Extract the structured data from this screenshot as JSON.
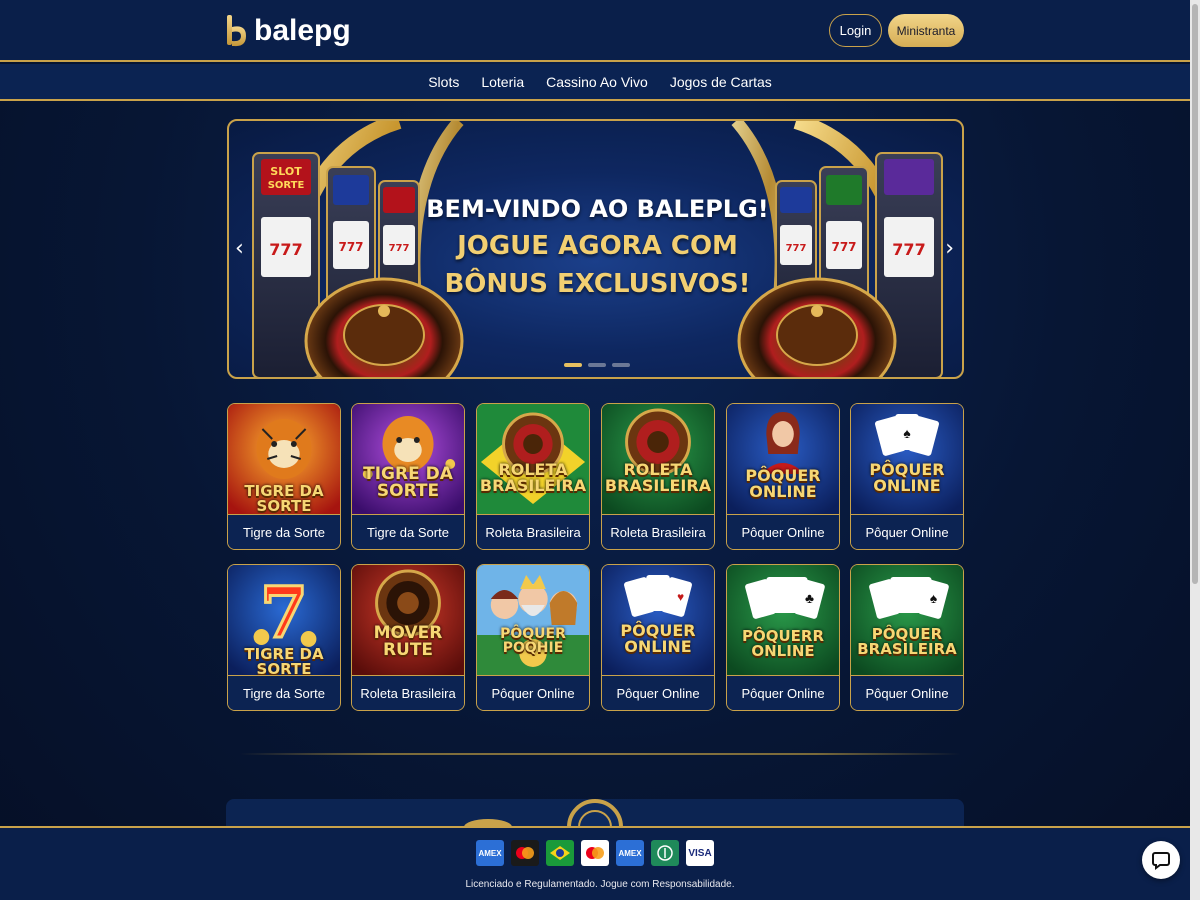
{
  "header": {
    "logo_text": "balepg",
    "login_label": "Login",
    "register_label": "Ministranta"
  },
  "nav": {
    "items": [
      {
        "label": "Slots"
      },
      {
        "label": "Loteria"
      },
      {
        "label": "Cassino Ao Vivo"
      },
      {
        "label": "Jogos de Cartas"
      }
    ]
  },
  "banner": {
    "line1": "BEM-VINDO AO BALEPLG!",
    "line2": "JOGUE AGORA COM",
    "line3": "BÔNUS EXCLUSIVOS!",
    "slide_count": 3,
    "active_slide": 1,
    "slot_sign_left": "SLOT SORTE"
  },
  "games": [
    {
      "title": "Tigre da Sorte",
      "art": "TIGRE DA SORTE",
      "theme": "tiger-red"
    },
    {
      "title": "Tigre da Sorte",
      "art": "TIGRE DA SORTE",
      "theme": "tiger-purple"
    },
    {
      "title": "Roleta Brasileira",
      "art": "ROLETA BRASILEIRA",
      "theme": "roulette-brazil"
    },
    {
      "title": "Roleta Brasileira",
      "art": "ROLETA BRASILEIRA",
      "theme": "roulette-green"
    },
    {
      "title": "Pôquer Online",
      "art": "PÔQUER ONLINE",
      "theme": "poker-dealer"
    },
    {
      "title": "Pôquer Online",
      "art": "PÔQUER ONLINE",
      "theme": "poker-cards-blue"
    },
    {
      "title": "Tigre da Sorte",
      "art": "TIGRE DA SORTE",
      "theme": "seven-blue"
    },
    {
      "title": "Roleta Brasileira",
      "art": "MOVER RUTE",
      "theme": "roulette-red"
    },
    {
      "title": "Pôquer Online",
      "art": "PÔQUER POQHIE",
      "theme": "poker-characters"
    },
    {
      "title": "Pôquer Online",
      "art": "PÔQUER ONLINE",
      "theme": "poker-cards-blue2"
    },
    {
      "title": "Pôquer Online",
      "art": "PÔQUERR ONLINE",
      "theme": "poker-cards-green"
    },
    {
      "title": "Pôquer Online",
      "art": "PÔQUER BRASILEIRA",
      "theme": "poker-cards-green2"
    }
  ],
  "footer": {
    "payment_methods": [
      "amex-icon",
      "mastercard-icon",
      "brazil-flag-icon",
      "mastercard-alt-icon",
      "amex-blue-icon",
      "pix-icon",
      "visa-icon"
    ],
    "visa_label": "VISA",
    "license_text": "Licenciado e Regulamentado. Jogue com Responsabilidade."
  },
  "colors": {
    "gold": "#c9a24a",
    "navy": "#0a1f4a",
    "accent_gold": "#f2cf72"
  }
}
